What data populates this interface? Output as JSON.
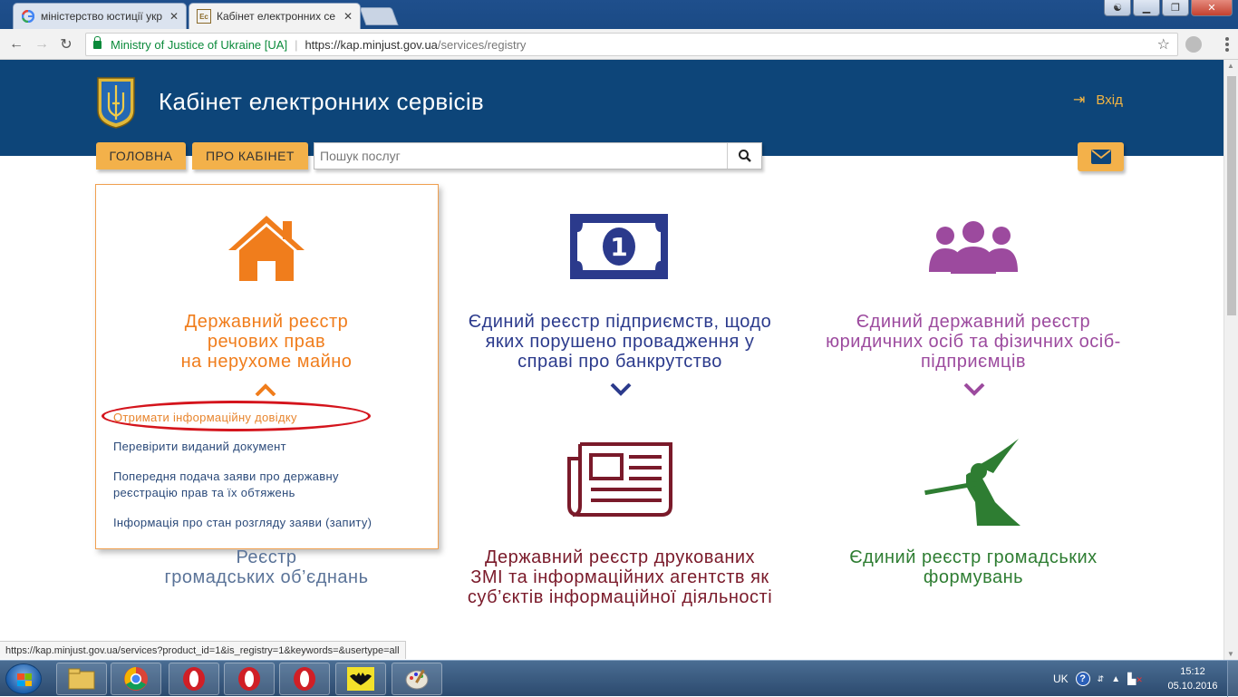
{
  "browser": {
    "tabs": [
      {
        "title": "міністерство юстиції укр",
        "favicon": "google-g"
      },
      {
        "title": "Кабінет електронних се",
        "favicon": "kes-icon"
      }
    ],
    "security_label": "Ministry of Justice of Ukraine [UA]",
    "url_host": "https://kap.minjust.gov.ua",
    "url_path": "/services/registry"
  },
  "site": {
    "title": "Кабінет електронних сервісів",
    "login_label": "Вхід",
    "nav": {
      "home": "ГОЛОВНА",
      "about": "ПРО КАБІНЕТ"
    },
    "search_placeholder": "Пошук послуг"
  },
  "services": [
    {
      "title_lines": [
        "Державний реєстр",
        "речових прав",
        "на нерухоме майно"
      ],
      "color": "#f07d1c",
      "icon": "house-icon",
      "expanded": true
    },
    {
      "title_lines": [
        "Єдиний реєстр підприємств, щодо",
        "яких порушено провадження у",
        "справі про банкрутство"
      ],
      "color": "#2b3a8c",
      "icon": "banknote-icon"
    },
    {
      "title_lines": [
        "Єдиний державний реєстр",
        "юридичних осіб та фізичних осіб-",
        "підприємців"
      ],
      "color": "#9c4a9e",
      "icon": "people-icon"
    },
    {
      "title_lines": [
        "Реєстр",
        "громадських об’єднань"
      ],
      "color": "#5a7398",
      "icon": "organization-icon"
    },
    {
      "title_lines": [
        "Державний реєстр друкованих",
        "ЗМІ та інформаційних агентств як",
        "суб’єктів інформаційної діяльності"
      ],
      "color": "#7a1a2a",
      "icon": "newspaper-icon"
    },
    {
      "title_lines": [
        "Єдиний реєстр громадських",
        "формувань"
      ],
      "color": "#2e7d32",
      "icon": "cossack-icon"
    }
  ],
  "sub_links": [
    [
      "Отримати інформаційну довідку"
    ],
    [
      "Перевірити виданий документ"
    ],
    [
      "Попередня подача заяви про державну",
      "реєстрацію прав та їх обтяжень"
    ],
    [
      "Інформація про стан розгляду заяви (запиту)"
    ]
  ],
  "status_url": "https://kap.minjust.gov.ua/services?product_id=1&is_registry=1&keywords=&usertype=all",
  "taskbar": {
    "lang": "UK",
    "time": "15:12",
    "date": "05.10.2016"
  }
}
